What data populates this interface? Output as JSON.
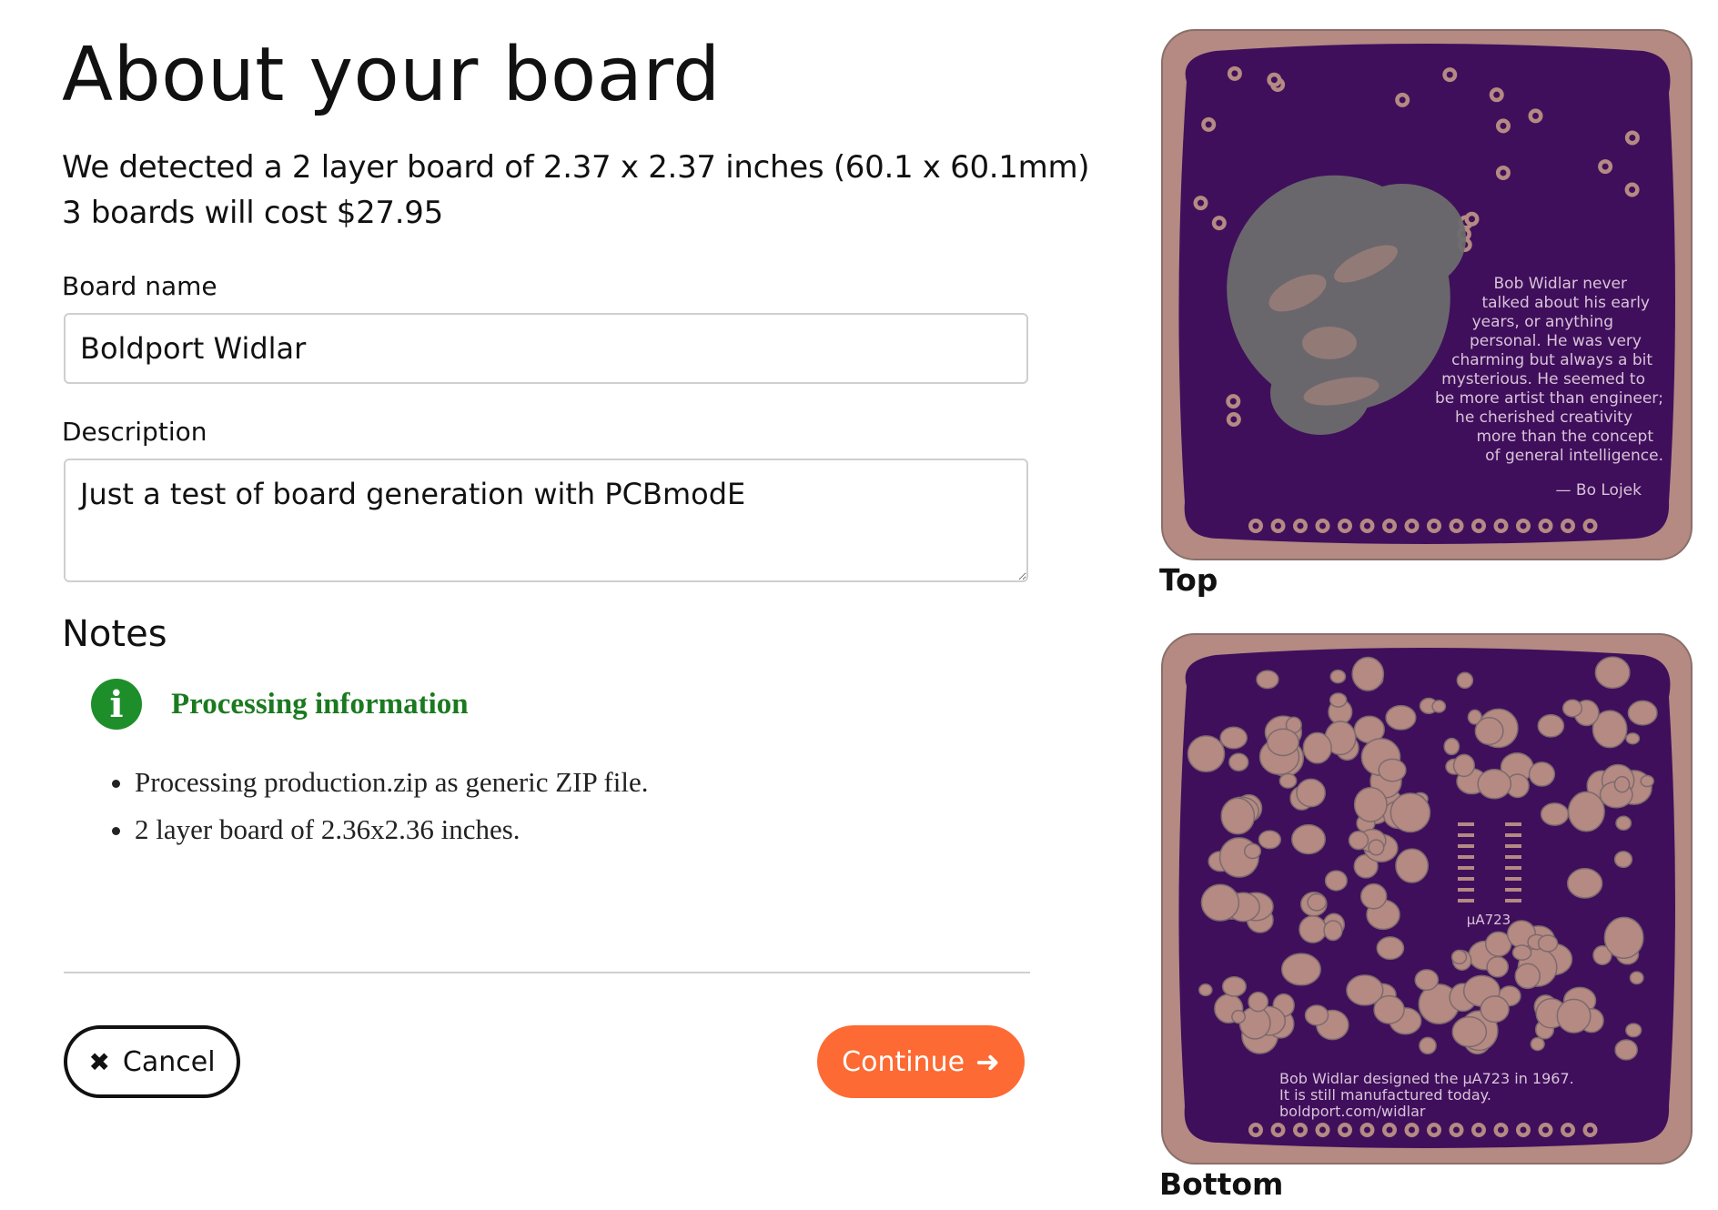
{
  "page": {
    "title": "About your board",
    "summary_line1": "We detected a 2 layer board of 2.37 x 2.37 inches (60.1 x 60.1mm)",
    "summary_line2": "3 boards will cost $27.95"
  },
  "form": {
    "name_label": "Board name",
    "name_value": "Boldport Widlar",
    "description_label": "Description",
    "description_value": "Just a test of board generation with PCBmodE"
  },
  "notes": {
    "title": "Notes",
    "info_title": "Processing information",
    "items": [
      "Processing production.zip as generic ZIP file.",
      "2 layer board of 2.36x2.36 inches."
    ]
  },
  "actions": {
    "cancel_label": "Cancel",
    "continue_label": "Continue"
  },
  "previews": {
    "top_caption": "Top",
    "bottom_caption": "Bottom",
    "top_quote": [
      "Bob Widlar never",
      "talked about his early",
      "years, or anything",
      "personal. He was very",
      "charming but always a bit",
      "mysterious. He seemed to",
      "be more artist than engineer;",
      "he cherished creativity",
      "more than the concept",
      "of general intelligence."
    ],
    "top_attribution": "— Bo Lojek",
    "bottom_chip_label": "μA723",
    "bottom_text": [
      "Bob Widlar designed the μA723 in 1967.",
      "It is still manufactured today.",
      "boldport.com/widlar"
    ]
  },
  "colors": {
    "board_purple": "#3f0f5c",
    "copper_pink": "#b48a82",
    "silkscreen": "#d9c3d6",
    "portrait_gray": "#6c6c6c",
    "accent_orange": "#fd6a33",
    "info_green": "#1e8e2a"
  },
  "icons": {
    "info": "info-icon",
    "cancel": "close-icon",
    "continue": "arrow-right-icon"
  }
}
